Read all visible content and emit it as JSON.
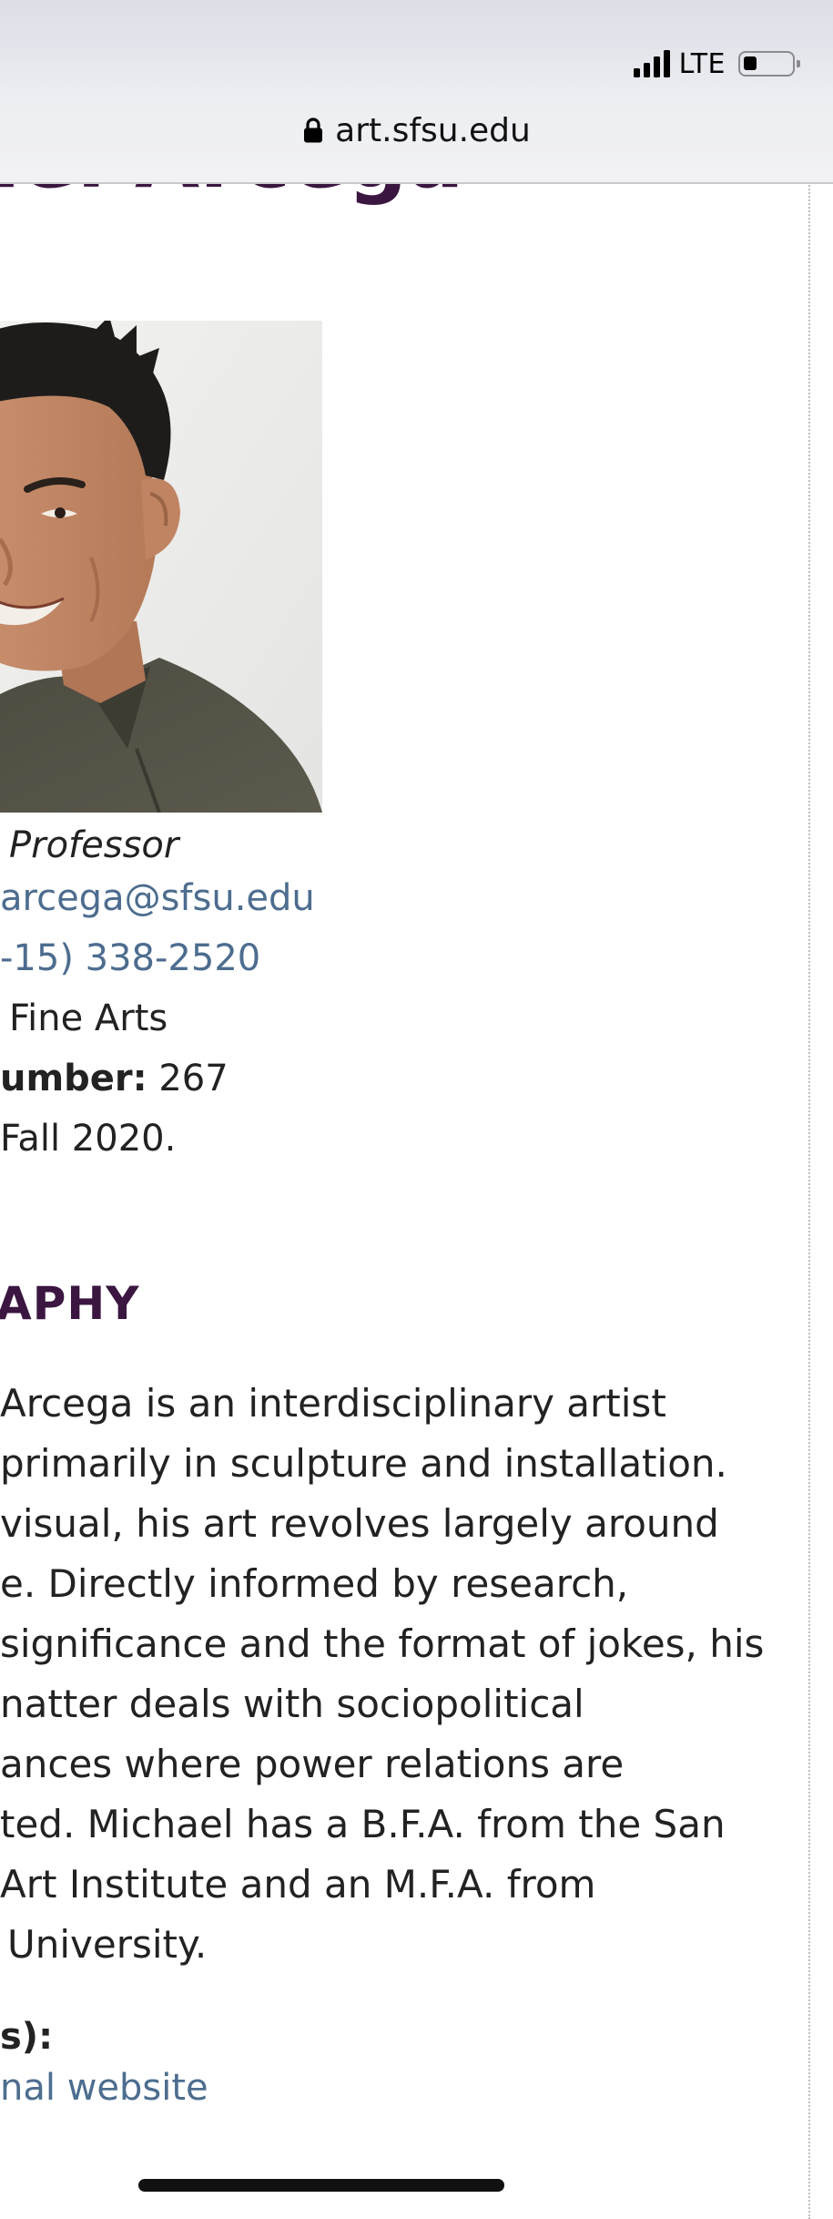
{
  "status_bar": {
    "network": "LTE"
  },
  "browser": {
    "url": "art.sfsu.edu"
  },
  "profile": {
    "name_heading_fragment": "ael Arcega",
    "title": "Professor",
    "email": "arcega@sfsu.edu",
    "phone": "-15) 338-2520",
    "department": "Fine Arts",
    "room_label": "umber:",
    "room_value": "267",
    "since": "Fall 2020."
  },
  "biography": {
    "heading": "APHY",
    "lines": [
      "Arcega is an interdisciplinary artist",
      "primarily in sculpture and installation.",
      "visual, his art revolves largely around",
      "e. Directly informed by research,",
      "significance and the format of jokes, his",
      "natter deals with sociopolitical",
      "ances where power relations are",
      "ted. Michael has a B.F.A. from the San",
      "Art Institute and an M.F.A. from",
      "University."
    ],
    "links_label": "s):",
    "link_text": "nal website"
  },
  "colors": {
    "heading": "#3a1640",
    "link": "#4d6d8f",
    "text": "#222222"
  }
}
